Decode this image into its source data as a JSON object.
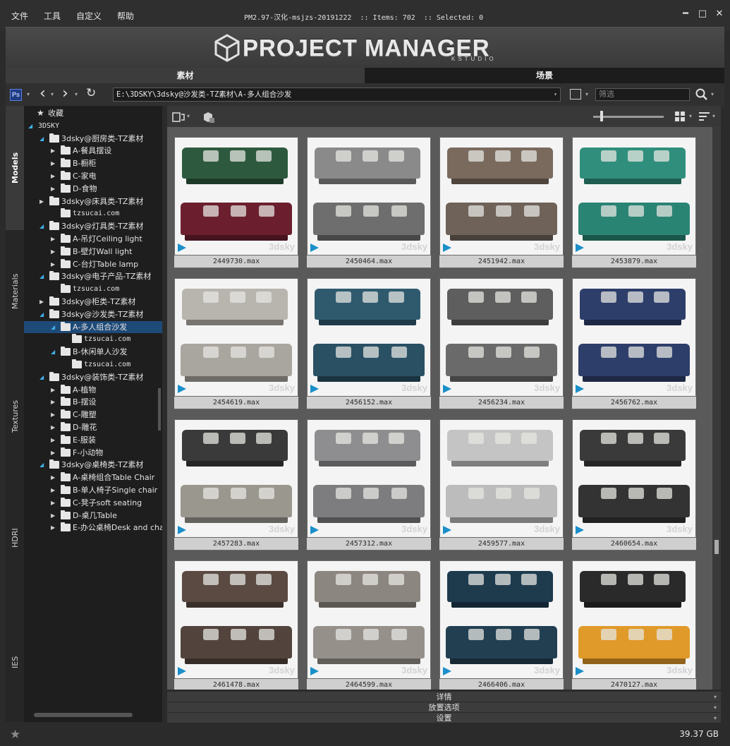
{
  "menu": [
    "文件",
    "工具",
    "自定义",
    "帮助"
  ],
  "window_title": "PM2.97-汉化-msjzs-20191222  :: Items: 702  :: Selected: 0",
  "window_controls": {
    "minimize": "━",
    "maximize": "□",
    "close": "✕"
  },
  "banner": {
    "logo": "PROJECT MANAGER",
    "sub": "KSTUDIO"
  },
  "tabs": [
    "素材",
    "场景"
  ],
  "toolbar": {
    "ps_label": "Ps",
    "path": "E:\\3DSKY\\3dsky@沙发类-TZ素材\\A-多人组合沙发",
    "filter_placeholder": "筛选",
    "back": "‹",
    "forward": "›",
    "refresh": "↻"
  },
  "side_tabs": [
    "Models",
    "Materials",
    "Textures",
    "HDRI",
    "IES"
  ],
  "tree": [
    {
      "label": "收藏",
      "level": 0,
      "arrow": "none",
      "icon": "star"
    },
    {
      "label": "3DSKY",
      "level": 0,
      "arrow": "open",
      "icon": "none"
    },
    {
      "label": "3dsky@厨房类-TZ素材",
      "level": 1,
      "arrow": "open",
      "icon": "folder"
    },
    {
      "label": "A-餐具摆设",
      "level": 2,
      "arrow": "closed",
      "icon": "folder"
    },
    {
      "label": "B-橱柜",
      "level": 2,
      "arrow": "closed",
      "icon": "folder"
    },
    {
      "label": "C-家电",
      "level": 2,
      "arrow": "closed",
      "icon": "folder"
    },
    {
      "label": "D-食物",
      "level": 2,
      "arrow": "closed",
      "icon": "folder"
    },
    {
      "label": "3dsky@床具类-TZ素材",
      "level": 1,
      "arrow": "closed",
      "icon": "folder"
    },
    {
      "label": "tzsucai.com",
      "level": 2,
      "arrow": "none",
      "icon": "folder"
    },
    {
      "label": "3dsky@灯具类-TZ素材",
      "level": 1,
      "arrow": "open",
      "icon": "folder"
    },
    {
      "label": "A-吊灯Ceiling light",
      "level": 2,
      "arrow": "closed",
      "icon": "folder"
    },
    {
      "label": "B-壁灯Wall light",
      "level": 2,
      "arrow": "closed",
      "icon": "folder"
    },
    {
      "label": "C-台灯Table lamp",
      "level": 2,
      "arrow": "closed",
      "icon": "folder"
    },
    {
      "label": "3dsky@电子产品-TZ素材",
      "level": 1,
      "arrow": "open",
      "icon": "folder"
    },
    {
      "label": "tzsucai.com",
      "level": 2,
      "arrow": "none",
      "icon": "folder"
    },
    {
      "label": "3dsky@柜类-TZ素材",
      "level": 1,
      "arrow": "closed",
      "icon": "folder"
    },
    {
      "label": "3dsky@沙发类-TZ素材",
      "level": 1,
      "arrow": "open",
      "icon": "folder"
    },
    {
      "label": "A-多人组合沙发",
      "level": 2,
      "arrow": "open",
      "icon": "folder",
      "selected": true
    },
    {
      "label": "tzsucai.com",
      "level": 3,
      "arrow": "none",
      "icon": "folder"
    },
    {
      "label": "B-休闲单人沙发",
      "level": 2,
      "arrow": "open",
      "icon": "folder"
    },
    {
      "label": "tzsucai.com",
      "level": 3,
      "arrow": "none",
      "icon": "folder"
    },
    {
      "label": "3dsky@装饰类-TZ素材",
      "level": 1,
      "arrow": "open",
      "icon": "folder"
    },
    {
      "label": "A-植物",
      "level": 2,
      "arrow": "closed",
      "icon": "folder"
    },
    {
      "label": "B-摆设",
      "level": 2,
      "arrow": "closed",
      "icon": "folder"
    },
    {
      "label": "C-雕塑",
      "level": 2,
      "arrow": "closed",
      "icon": "folder"
    },
    {
      "label": "D-雕花",
      "level": 2,
      "arrow": "closed",
      "icon": "folder"
    },
    {
      "label": "E-服装",
      "level": 2,
      "arrow": "closed",
      "icon": "folder"
    },
    {
      "label": "F-小动物",
      "level": 2,
      "arrow": "closed",
      "icon": "folder"
    },
    {
      "label": "3dsky@桌椅类-TZ素材",
      "level": 1,
      "arrow": "open",
      "icon": "folder"
    },
    {
      "label": "A-桌椅组合Table Chair",
      "level": 2,
      "arrow": "closed",
      "icon": "folder"
    },
    {
      "label": "B-单人椅子Single chair",
      "level": 2,
      "arrow": "closed",
      "icon": "folder"
    },
    {
      "label": "C-凳子soft seating",
      "level": 2,
      "arrow": "closed",
      "icon": "folder"
    },
    {
      "label": "D-桌几Table",
      "level": 2,
      "arrow": "closed",
      "icon": "folder"
    },
    {
      "label": "E-办公桌椅Desk and chair",
      "level": 2,
      "arrow": "closed",
      "icon": "folder"
    }
  ],
  "items": [
    {
      "name": "2449730.max",
      "colors": [
        "#2d5a3e",
        "#6b1f2e"
      ]
    },
    {
      "name": "2450464.max",
      "colors": [
        "#8a8a8a",
        "#6e6e6e"
      ]
    },
    {
      "name": "2451942.max",
      "colors": [
        "#7a6a5e",
        "#6e6259"
      ]
    },
    {
      "name": "2453879.max",
      "colors": [
        "#2f8f7c",
        "#2a8474"
      ]
    },
    {
      "name": "2454619.max",
      "colors": [
        "#b8b4ae",
        "#a9a59f"
      ]
    },
    {
      "name": "2456152.max",
      "colors": [
        "#2f5a6e",
        "#2a5064"
      ]
    },
    {
      "name": "2456234.max",
      "colors": [
        "#5e5e5e",
        "#6a6a6a"
      ]
    },
    {
      "name": "2456762.max",
      "colors": [
        "#2e3e6a",
        "#2e3e6a"
      ]
    },
    {
      "name": "2457283.max",
      "colors": [
        "#3a3a3a",
        "#9a978f"
      ]
    },
    {
      "name": "2457312.max",
      "colors": [
        "#8e8e90",
        "#7d7d80"
      ]
    },
    {
      "name": "2459577.max",
      "colors": [
        "#c4c4c4",
        "#bcbcbc"
      ]
    },
    {
      "name": "2460654.max",
      "colors": [
        "#3a3a3a",
        "#333333"
      ]
    },
    {
      "name": "2461478.max",
      "colors": [
        "#5a4a42",
        "#52443d"
      ]
    },
    {
      "name": "2464599.max",
      "colors": [
        "#8c8680",
        "#96908a"
      ]
    },
    {
      "name": "2466406.max",
      "colors": [
        "#1e3b4e",
        "#223f52"
      ]
    },
    {
      "name": "2470127.max",
      "colors": [
        "#2a2a2a",
        "#e09a2a"
      ]
    }
  ],
  "watermark": "3dsky",
  "panels": [
    "详情",
    "放置选项",
    "设置"
  ],
  "status": {
    "disk": "39.37 GB"
  }
}
